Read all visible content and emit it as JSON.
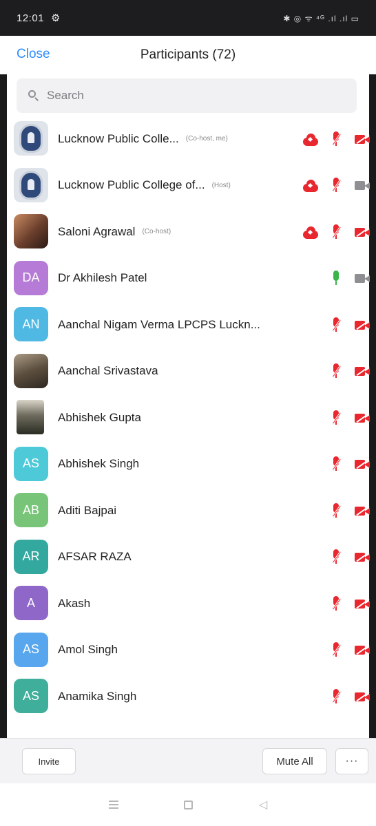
{
  "status_bar": {
    "time": "12:01",
    "right_icons": "✱ ◎ ᯤ ⁴ᴳ .ıl .ıl ▭"
  },
  "header": {
    "close_label": "Close",
    "title": "Participants (72)"
  },
  "search": {
    "placeholder": "Search"
  },
  "participants": [
    {
      "name": "Lucknow Public Colle...",
      "role": "(Co-host, me)",
      "avatar_type": "logo",
      "cloud": true,
      "mic": "muted",
      "video": "off"
    },
    {
      "name": "Lucknow Public College of...",
      "role": "(Host)",
      "avatar_type": "logo",
      "cloud": true,
      "mic": "muted",
      "video": "on"
    },
    {
      "name": "Saloni Agrawal",
      "role": "(Co-host)",
      "avatar_type": "photo",
      "cloud": true,
      "mic": "muted",
      "video": "off"
    },
    {
      "name": "Dr Akhilesh Patel",
      "role": "",
      "avatar_initials": "DA",
      "avatar_color": "#b57bd6",
      "mic": "on",
      "video": "on"
    },
    {
      "name": "Aanchal Nigam Verma LPCPS Luckn...",
      "role": "",
      "avatar_initials": "AN",
      "avatar_color": "#4fb9e4",
      "mic": "muted",
      "video": "off"
    },
    {
      "name": "Aanchal Srivastava",
      "role": "",
      "avatar_type": "photo",
      "mic": "muted",
      "video": "off"
    },
    {
      "name": "Abhishek Gupta",
      "role": "",
      "avatar_type": "photo",
      "mic": "muted",
      "video": "off"
    },
    {
      "name": "Abhishek Singh",
      "role": "",
      "avatar_initials": "AS",
      "avatar_color": "#4ec9d8",
      "mic": "muted",
      "video": "off"
    },
    {
      "name": "Aditi Bajpai",
      "role": "",
      "avatar_initials": "AB",
      "avatar_color": "#78c57a",
      "mic": "muted",
      "video": "off"
    },
    {
      "name": "AFSAR RAZA",
      "role": "",
      "avatar_initials": "AR",
      "avatar_color": "#33a89e",
      "mic": "muted",
      "video": "off"
    },
    {
      "name": "Akash",
      "role": "",
      "avatar_initials": "A",
      "avatar_color": "#8e67c9",
      "mic": "muted",
      "video": "off"
    },
    {
      "name": "Amol Singh",
      "role": "",
      "avatar_initials": "AS",
      "avatar_color": "#58a7ee",
      "mic": "muted",
      "video": "off"
    },
    {
      "name": "Anamika Singh",
      "role": "",
      "avatar_initials": "AS",
      "avatar_color": "#3fae9a",
      "mic": "muted",
      "video": "off"
    }
  ],
  "bottom_bar": {
    "invite_label": "Invite",
    "mute_all_label": "Mute All",
    "more_label": "···"
  },
  "colors": {
    "accent": "#2d8cff",
    "muted_red": "#e8272f",
    "mic_on_green": "#3bb54a"
  }
}
